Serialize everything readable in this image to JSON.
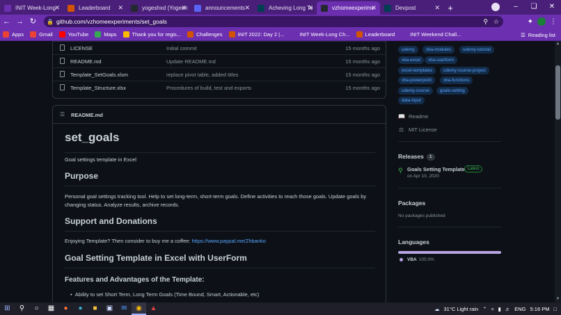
{
  "browser": {
    "tabs": [
      {
        "label": "INIT Week-Long",
        "icon": "list-icon",
        "color": "#6b2fb0",
        "active": false
      },
      {
        "label": "Leaderboard",
        "icon": "trophy-icon",
        "color": "#d35400",
        "active": false
      },
      {
        "label": "yogeshxd (Yogesh",
        "icon": "github-icon",
        "color": "#24292f",
        "active": false
      },
      {
        "label": "announcements",
        "icon": "discord-icon",
        "color": "#5865f2",
        "active": false
      },
      {
        "label": "Acheving Long Te",
        "icon": "devpost-icon",
        "color": "#003e54",
        "active": false
      },
      {
        "label": "vzhomeexperime",
        "icon": "github-icon",
        "color": "#24292f",
        "active": true
      },
      {
        "label": "Devpost",
        "icon": "devpost-icon",
        "color": "#003e54",
        "active": false
      }
    ],
    "url": "github.com/vzhomeexperiments/set_goals",
    "bookmarks": [
      {
        "label": "Apps",
        "icon": "apps-grid-icon",
        "color": "#ea4335"
      },
      {
        "label": "Gmail",
        "icon": "gmail-icon",
        "color": "#ea4335"
      },
      {
        "label": "YouTube",
        "icon": "youtube-icon",
        "color": "#ff0000"
      },
      {
        "label": "Maps",
        "icon": "maps-icon",
        "color": "#34a853"
      },
      {
        "label": "Thank you for regis...",
        "icon": "google-forms-icon",
        "color": "#fbbc04"
      },
      {
        "label": "Challenges",
        "icon": "trophy-icon",
        "color": "#d35400"
      },
      {
        "label": "INIT 2022: Day 2 |...",
        "icon": "trophy-icon",
        "color": "#d35400"
      },
      {
        "label": "INIT Week-Long Ch...",
        "icon": "list-icon",
        "color": "#6b2fb0"
      },
      {
        "label": "Leaderboard",
        "icon": "trophy-icon",
        "color": "#d35400"
      },
      {
        "label": "INIT Weekend Chall...",
        "icon": "list-icon",
        "color": "#6b2fb0"
      }
    ],
    "reading_list": "Reading list"
  },
  "files": [
    {
      "name": "LICENSE",
      "message": "Initial commit",
      "age": "15 months ago"
    },
    {
      "name": "README.md",
      "message": "Update README.md",
      "age": "15 months ago"
    },
    {
      "name": "Template_SetGoals.xlsm",
      "message": "replace pivot table, added titles",
      "age": "15 months ago"
    },
    {
      "name": "Template_Structure.xlsx",
      "message": "Procedures of build, test and exports",
      "age": "15 months ago"
    }
  ],
  "readme": {
    "filename": "README.md",
    "title": "set_goals",
    "tagline": "Goal settings template in Excel",
    "purpose_heading": "Purpose",
    "purpose_text": "Personal goal settings tracking tool. Help to set long-term, short-term goals. Define activities to reach those goals. Update goals by changing status. Analyze results, archive records.",
    "support_heading": "Support and Donations",
    "support_text": "Enjoying Template? Then consider to buy me a coffee: ",
    "support_link": "https://www.paypal.me/Zhbanko",
    "template_heading": "Goal Setting Template in Excel with UserForm",
    "features_heading": "Features and Advantages of the Template:",
    "feature_1": "Ability to set Short Term, Long Term Goals (Time Bound, Smart, Actionable, etc)"
  },
  "sidebar": {
    "topics": [
      "udemy",
      "vba-modules",
      "udemy-tutorial",
      "vba-excel",
      "vba-userform",
      "excel-templates",
      "udemy-course-project",
      "vba-powerpoint",
      "vba-functions",
      "udemy-course",
      "goals-setting",
      "data-input"
    ],
    "readme_link": "Readme",
    "license_link": "MIT License",
    "releases_heading": "Releases",
    "releases_count": "1",
    "release_name": "Goals Setting Template",
    "release_badge": "Latest",
    "release_date": "on Apr 10, 2020",
    "packages_heading": "Packages",
    "packages_text": "No packages published",
    "languages_heading": "Languages",
    "language_name": "VBA",
    "language_pct": "100.0%",
    "language_color": "#b6a4e3"
  },
  "taskbar": {
    "weather": "31°C  Light rain",
    "lang": "ENG",
    "time": "5:16 PM"
  }
}
